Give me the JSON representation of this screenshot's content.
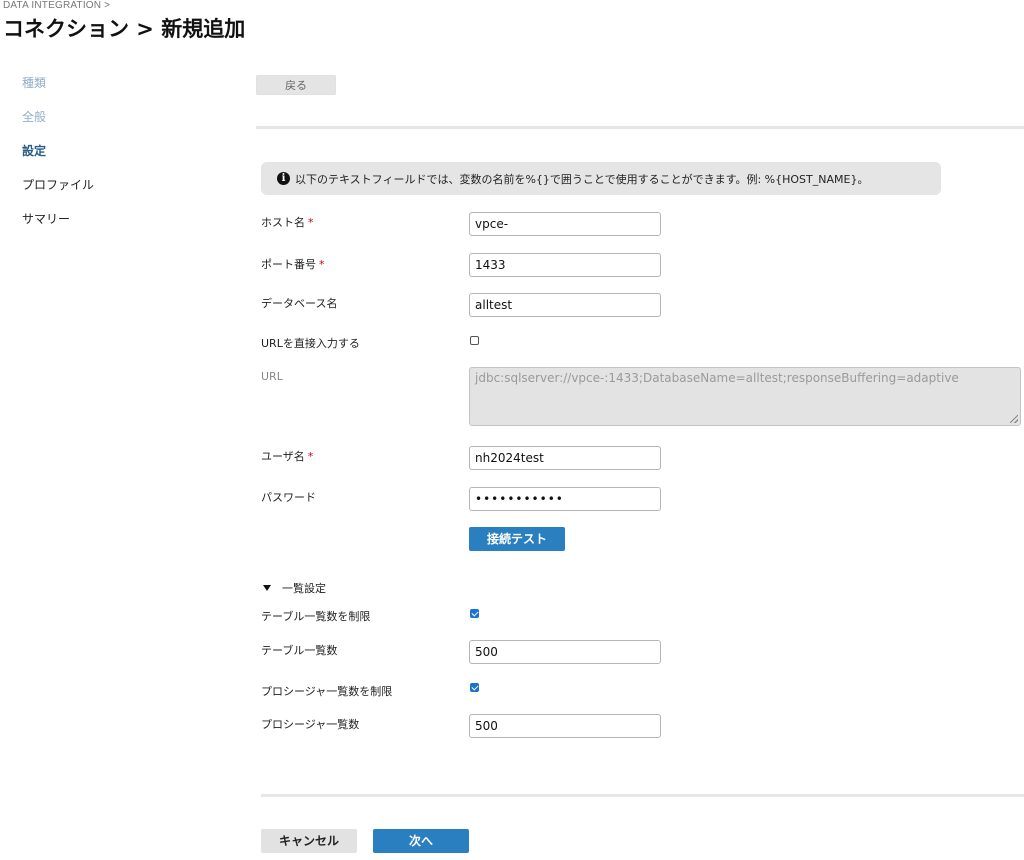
{
  "header": {
    "breadcrumb": "DATA INTEGRATION >",
    "title": "コネクション > 新規追加"
  },
  "sidebar": {
    "steps": [
      {
        "label": "種類",
        "state": "done"
      },
      {
        "label": "全般",
        "state": "done"
      },
      {
        "label": "設定",
        "state": "active"
      },
      {
        "label": "プロファイル",
        "state": "pending"
      },
      {
        "label": "サマリー",
        "state": "pending"
      }
    ]
  },
  "toolbar": {
    "back_label": "戻る"
  },
  "info": {
    "icon": "info-icon",
    "icon_glyph": "i",
    "text": "以下のテキストフィールドでは、変数の名前を%{}で囲うことで使用することができます。例: %{HOST_NAME}。"
  },
  "form": {
    "required_mark": "*",
    "host": {
      "label": "ホスト名",
      "value": "vpce-"
    },
    "port": {
      "label": "ポート番号",
      "value": "1433"
    },
    "database": {
      "label": "データベース名",
      "value": "alltest"
    },
    "direct_url": {
      "label": "URLを直接入力する",
      "checked": false
    },
    "url": {
      "label": "URL",
      "value": "jdbc:sqlserver://vpce-:1433;DatabaseName=alltest;responseBuffering=adaptive"
    },
    "user": {
      "label": "ユーザ名",
      "value": "nh2024test"
    },
    "password": {
      "label": "パスワード",
      "value": "•••••••••••"
    },
    "test_button": "接続テスト"
  },
  "list_settings": {
    "title": "一覧設定",
    "expanded": true,
    "limit_tables": {
      "label": "テーブル一覧数を制限",
      "checked": true
    },
    "table_count": {
      "label": "テーブル一覧数",
      "value": "500"
    },
    "limit_procedures": {
      "label": "プロシージャ一覧数を制限",
      "checked": true
    },
    "procedure_count": {
      "label": "プロシージャ一覧数",
      "value": "500"
    }
  },
  "footer": {
    "cancel_label": "キャンセル",
    "next_label": "次へ"
  },
  "colors": {
    "primary": "#2a7fc1",
    "active_step": "#2b5d87",
    "done_step": "#93adc8",
    "required": "#cc0000"
  }
}
